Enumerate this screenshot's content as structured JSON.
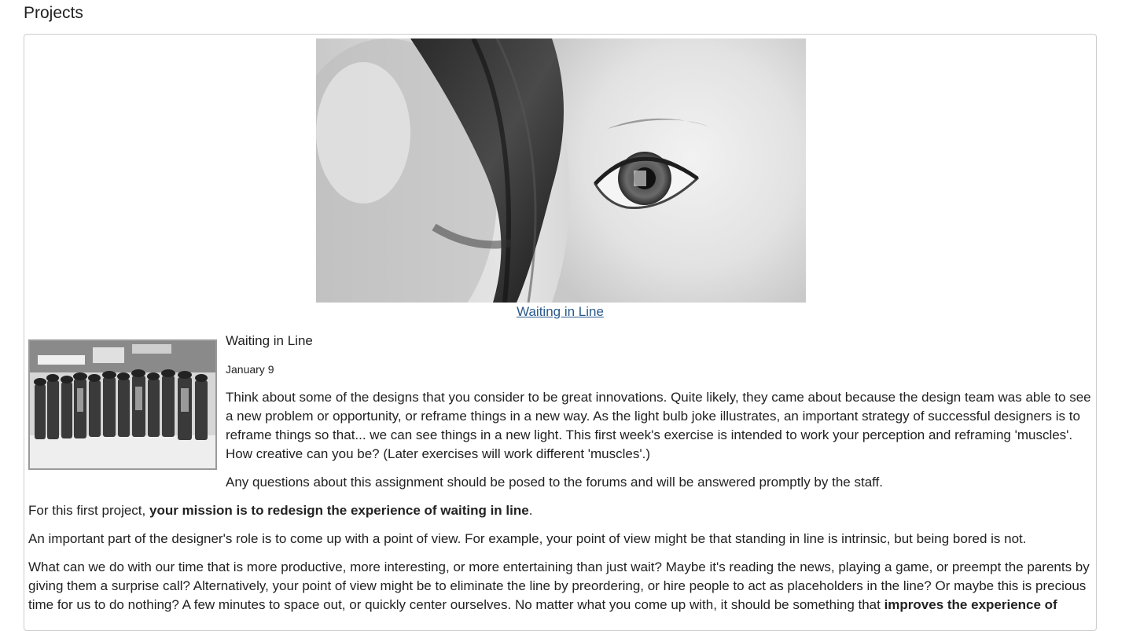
{
  "page": {
    "title": "Projects"
  },
  "hero": {
    "image_icon": "eye-photo",
    "link_label": "Waiting in Line"
  },
  "post": {
    "thumbnail_icon": "breadline-photo",
    "title": "Waiting in Line",
    "date": "January 9",
    "intro": "Think about some of the designs that you consider to be great innovations. Quite likely, they came about because the design team was able to see a new problem or opportunity, or reframe things in a new way. As the light bulb joke illustrates, an important strategy of successful designers is to reframe things so that... we can see things in a new light. This first week's exercise is intended to work your perception and reframing 'muscles'. How creative can you be? (Later exercises will work different 'muscles'.)",
    "questions": "Any questions about this assignment should be posed to the forums and will be answered promptly by the staff.",
    "mission_prefix": "For this first project, ",
    "mission_bold": "your mission is to redesign the experience of waiting in line",
    "mission_suffix": ".",
    "pov": "An important part of the designer's role is to come up with a point of view. For example, your point of view might be that standing in line is intrinsic, but being bored is not.",
    "ideas_text": "What can we do with our time that is more productive, more interesting, or more entertaining than just wait? Maybe it's reading the news, playing a game, or preempt the parents by giving them a surprise call? Alternatively, your point of view might be to eliminate the line by preordering, or hire people to act as placeholders in the line? Or maybe this is precious time for us to do nothing? A few minutes to space out, or quickly center ourselves. No matter what you come up with, it should be something that ",
    "ideas_bold": "improves the experience of"
  }
}
